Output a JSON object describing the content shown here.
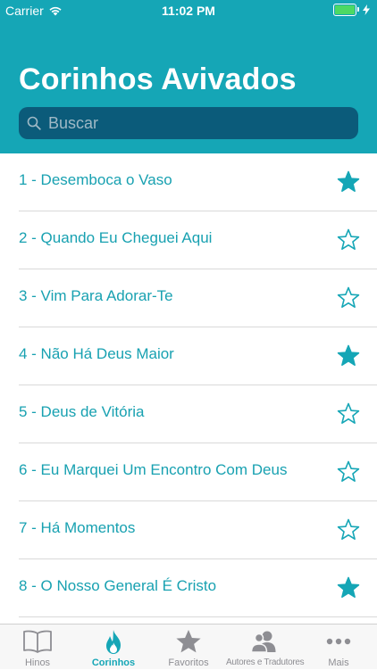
{
  "status_bar": {
    "carrier": "Carrier",
    "time": "11:02 PM"
  },
  "header": {
    "title": "Corinhos Avivados"
  },
  "search": {
    "placeholder": "Buscar"
  },
  "songs": [
    {
      "label": "1 - Desemboca o Vaso",
      "favorite": true
    },
    {
      "label": "2 - Quando Eu Cheguei Aqui",
      "favorite": false
    },
    {
      "label": "3 - Vim Para Adorar-Te",
      "favorite": false
    },
    {
      "label": "4 - Não Há Deus Maior",
      "favorite": true
    },
    {
      "label": "5 - Deus de Vitória",
      "favorite": false
    },
    {
      "label": "6 - Eu Marquei Um Encontro Com Deus",
      "favorite": false
    },
    {
      "label": "7 - Há Momentos",
      "favorite": false
    },
    {
      "label": "8 - O Nosso General É Cristo",
      "favorite": true
    }
  ],
  "tabs": [
    {
      "label": "Hinos",
      "icon": "book-icon",
      "active": false
    },
    {
      "label": "Corinhos",
      "icon": "flame-icon",
      "active": true
    },
    {
      "label": "Favoritos",
      "icon": "star-icon",
      "active": false
    },
    {
      "label": "Autores e Tradutores",
      "icon": "people-icon",
      "active": false
    },
    {
      "label": "Mais",
      "icon": "more-icon",
      "active": false
    }
  ],
  "colors": {
    "accent": "#15a6b6",
    "search_bg": "#0b5b7a",
    "battery": "#4cd964",
    "tab_inactive": "#8e8e93"
  }
}
